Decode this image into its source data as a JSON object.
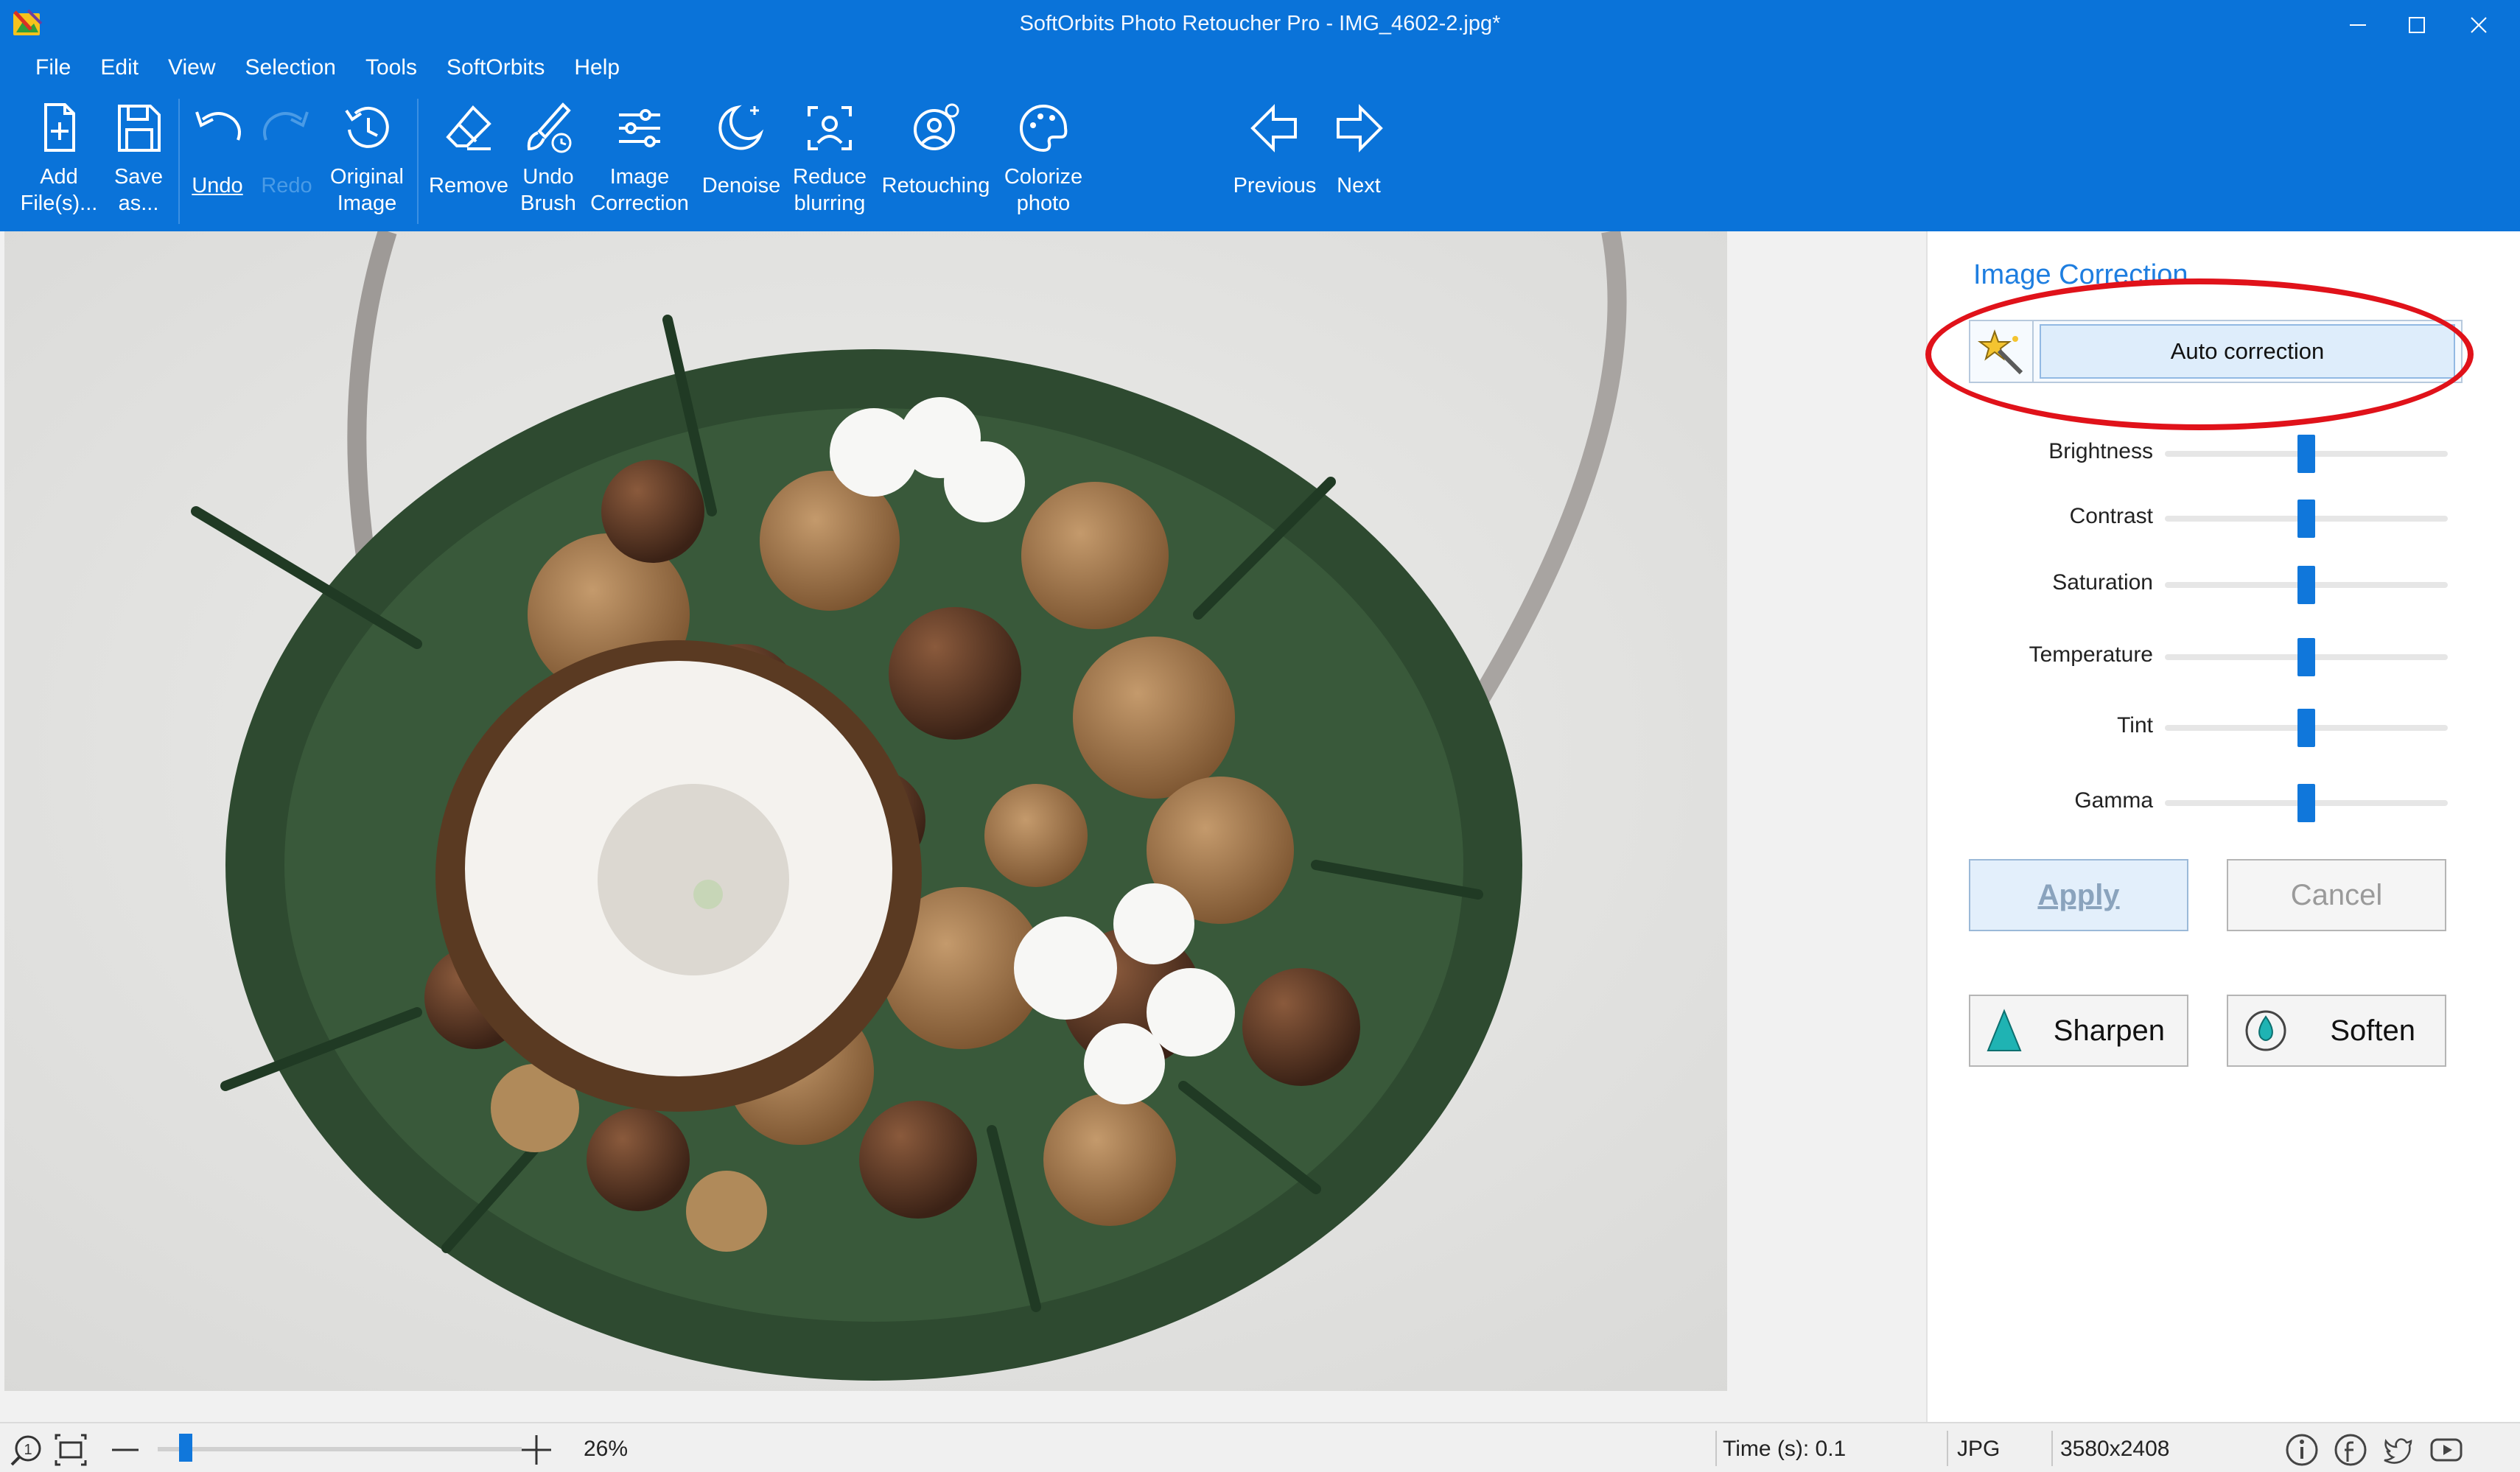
{
  "window": {
    "title": "SoftOrbits Photo Retoucher Pro - IMG_4602-2.jpg*"
  },
  "menu": [
    {
      "label": "File"
    },
    {
      "label": "Edit"
    },
    {
      "label": "View"
    },
    {
      "label": "Selection"
    },
    {
      "label": "Tools"
    },
    {
      "label": "SoftOrbits"
    },
    {
      "label": "Help"
    }
  ],
  "toolbar": {
    "add_files": "Add\nFile(s)...",
    "save_as": "Save\nas...",
    "undo": "Undo",
    "redo": "Redo",
    "original_image": "Original\nImage",
    "remove": "Remove",
    "undo_brush": "Undo\nBrush",
    "image_correction": "Image\nCorrection",
    "denoise": "Denoise",
    "reduce_blurring": "Reduce\nblurring",
    "retouching": "Retouching",
    "colorize_photo": "Colorize\nphoto",
    "previous": "Previous",
    "next": "Next"
  },
  "panel": {
    "title": "Image Correction",
    "auto_correction": "Auto correction",
    "sliders": [
      {
        "label": "Brightness",
        "value": 0.5
      },
      {
        "label": "Contrast",
        "value": 0.5
      },
      {
        "label": "Saturation",
        "value": 0.5
      },
      {
        "label": "Temperature",
        "value": 0.5
      },
      {
        "label": "Tint",
        "value": 0.5
      },
      {
        "label": "Gamma",
        "value": 0.5
      }
    ],
    "apply": "Apply",
    "cancel": "Cancel",
    "sharpen": "Sharpen",
    "soften": "Soften"
  },
  "status": {
    "zoom": "26%",
    "zoom_fraction": 0.06,
    "time": "Time (s): 0.1",
    "format": "JPG",
    "dimensions": "3580x2408"
  },
  "colors": {
    "accent": "#0a73d9",
    "highlight": "#e0121a",
    "slider": "#1077db"
  },
  "icons": [
    "app-logo-icon",
    "add-file-icon",
    "save-icon",
    "undo-icon",
    "redo-icon",
    "history-icon",
    "eraser-icon",
    "undo-brush-icon",
    "sliders-icon",
    "denoise-icon",
    "reduce-blur-icon",
    "retouch-icon",
    "palette-icon",
    "arrow-left-icon",
    "arrow-right-icon",
    "magic-wand-icon",
    "sharpen-icon",
    "soften-icon",
    "zoom-icon",
    "fit-icon",
    "info-icon",
    "facebook-icon",
    "twitter-icon",
    "youtube-icon"
  ]
}
